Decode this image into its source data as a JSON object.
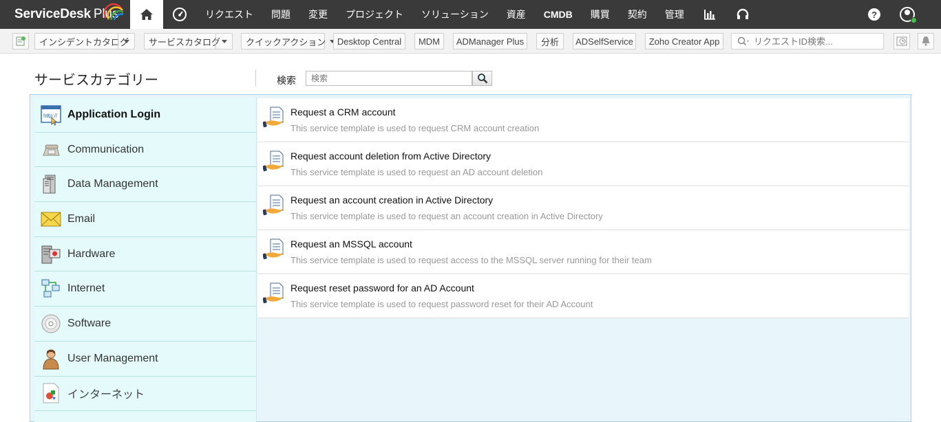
{
  "app": {
    "logo_text": "ServiceDesk",
    "logo_plus": "Plus"
  },
  "nav": {
    "items": [
      {
        "label": "リクエスト"
      },
      {
        "label": "問題"
      },
      {
        "label": "変更"
      },
      {
        "label": "プロジェクト"
      },
      {
        "label": "ソリューション"
      },
      {
        "label": "資産"
      },
      {
        "label": "CMDB"
      },
      {
        "label": "購買"
      },
      {
        "label": "契約"
      },
      {
        "label": "管理"
      }
    ],
    "help_label": "?"
  },
  "toolbar": {
    "incident_catalog": "インシデントカタログ",
    "service_catalog": "サービスカタログ",
    "quick_actions": "クイックアクション",
    "buttons": [
      "Desktop Central",
      "MDM",
      "ADManager Plus",
      "分析",
      "ADSelfService",
      "Zoho Creator App"
    ],
    "search_placeholder": "リクエストID検索..."
  },
  "page": {
    "title": "サービスカテゴリー",
    "search_label": "検索",
    "search_placeholder": "検索"
  },
  "categories": [
    {
      "name": "Application Login",
      "icon": "browser-icon",
      "active": true
    },
    {
      "name": "Communication",
      "icon": "telephone-icon"
    },
    {
      "name": "Data Management",
      "icon": "server-icon"
    },
    {
      "name": "Email",
      "icon": "envelope-icon"
    },
    {
      "name": "Hardware",
      "icon": "hardware-icon"
    },
    {
      "name": "Internet",
      "icon": "network-icon"
    },
    {
      "name": "Software",
      "icon": "cd-icon"
    },
    {
      "name": "User Management",
      "icon": "user-icon"
    },
    {
      "name": "インターネット",
      "icon": "document-shapes-icon"
    }
  ],
  "templates": [
    {
      "title": "Request a CRM account",
      "desc": "This service template is used to request CRM account creation"
    },
    {
      "title": "Request account deletion from Active Directory",
      "desc": "This service template is used to request an AD account deletion"
    },
    {
      "title": "Request an account creation in Active Directory",
      "desc": "This service template is used to request an account creation in Active Directory"
    },
    {
      "title": "Request an MSSQL account",
      "desc": "This service template is used to request access to the MSSQL server running for their team"
    },
    {
      "title": "Request reset password for an AD Account",
      "desc": "This service template is used to request password reset for their AD Account"
    }
  ],
  "colors": {
    "nav_bg": "#3a3a3a",
    "panel_bg": "#e8f6fc",
    "sidebar_bg": "#e5fbfb",
    "accent_green": "#45c04a"
  }
}
